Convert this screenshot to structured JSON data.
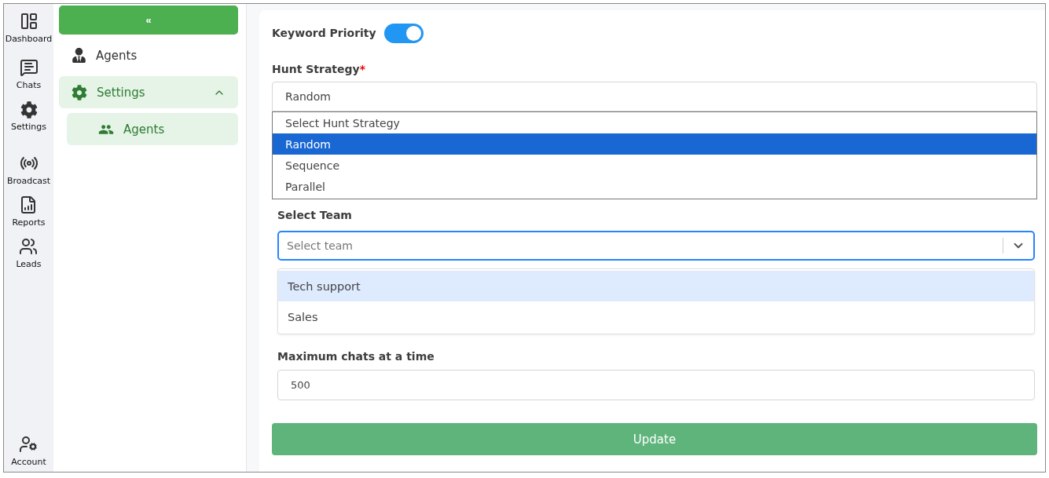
{
  "rail": [
    {
      "label": "Dashboard",
      "kind": "dashboard"
    },
    {
      "label": "Chats",
      "kind": "chat"
    },
    {
      "label": "Settings",
      "kind": "settings"
    },
    {
      "label": "Broadcast",
      "kind": "broadcast"
    },
    {
      "label": "Reports",
      "kind": "reports"
    },
    {
      "label": "Leads",
      "kind": "leads"
    }
  ],
  "rail_bottom": {
    "label": "Account",
    "kind": "account"
  },
  "collapse_button": "«",
  "sidebar": {
    "items": [
      {
        "label": "Agents",
        "kind": "agent",
        "selected": false
      },
      {
        "label": "Settings",
        "kind": "settings",
        "selected": true,
        "expanded": true,
        "children": [
          {
            "label": "Agents",
            "kind": "people",
            "selected": true
          }
        ]
      }
    ]
  },
  "form": {
    "keyword_priority": {
      "label": "Keyword Priority",
      "on": true
    },
    "hunt_strategy": {
      "label": "Hunt Strategy",
      "required_mark": "*",
      "value": "Random",
      "options": [
        {
          "label": "Select Hunt Strategy",
          "selected": false
        },
        {
          "label": "Random",
          "selected": true
        },
        {
          "label": "Sequence",
          "selected": false
        },
        {
          "label": "Parallel",
          "selected": false
        }
      ]
    },
    "select_team": {
      "label": "Select Team",
      "placeholder": "Select team",
      "options": [
        {
          "label": "Tech support",
          "selected": true
        },
        {
          "label": "Sales",
          "selected": false
        }
      ]
    },
    "max_chats": {
      "label": "Maximum chats at a time",
      "value": "500"
    },
    "submit": "Update"
  }
}
